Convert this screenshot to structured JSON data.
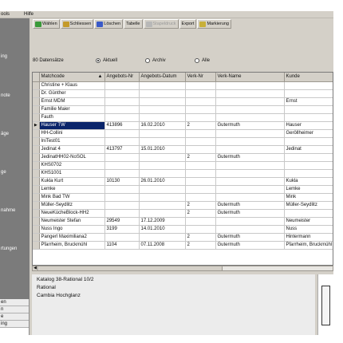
{
  "menubar": {
    "tools": "ools",
    "help": "Hilfe"
  },
  "sidebar": {
    "labels": [
      "ing",
      "note",
      "äge",
      "ge",
      "nahme",
      "rtungen"
    ],
    "bottom": [
      "en",
      "n",
      "e",
      "ing"
    ]
  },
  "toolbar": {
    "buttons": [
      {
        "label": "Wählen",
        "icon": "check-icon",
        "color": "#3a9a3a",
        "disabled": false
      },
      {
        "label": "Schliessen",
        "icon": "close-door-icon",
        "color": "#c49a2a",
        "disabled": false
      },
      {
        "label": "Löschen",
        "icon": "delete-icon",
        "color": "#3a5ac8",
        "disabled": false
      },
      {
        "label": "Tabelle",
        "icon": "",
        "color": "",
        "disabled": false
      },
      {
        "label": "Stapeldruck",
        "icon": "printer-icon",
        "color": "#9a9a9a",
        "disabled": true
      },
      {
        "label": "Export",
        "icon": "",
        "color": "",
        "disabled": false
      },
      {
        "label": "Markierung",
        "icon": "marker-icon",
        "color": "#c8b03a",
        "disabled": false
      }
    ]
  },
  "filter": {
    "count": "80 Datensätze",
    "options": [
      {
        "label": "Aktuell",
        "selected": true
      },
      {
        "label": "Archiv",
        "selected": false
      },
      {
        "label": "Alle",
        "selected": false
      }
    ]
  },
  "grid": {
    "columns": [
      "Matchcode",
      "Angebots-Nr",
      "Angebots-Datum",
      "Verk-Nr",
      "Verk-Name",
      "Kunde"
    ],
    "selected_row": 4,
    "rows": [
      [
        "Christine + Klaus",
        "",
        "",
        "",
        "",
        ""
      ],
      [
        "Dr. Günther",
        "",
        "",
        "",
        "",
        ""
      ],
      [
        "Ernst MDM",
        "",
        "",
        "",
        "",
        "Ernst"
      ],
      [
        "Familie Maier",
        "",
        "",
        "",
        "",
        ""
      ],
      [
        "Fauth",
        "",
        "",
        "",
        "",
        ""
      ],
      [
        "Hauser TW",
        "413896",
        "16.02.2010",
        "2",
        "Gutermuth",
        "Hauser"
      ],
      [
        "HH-Collini",
        "",
        "",
        "",
        "",
        "Geröllheimer"
      ],
      [
        "IniTest01",
        "",
        "",
        "",
        "",
        ""
      ],
      [
        "Jedinat 4",
        "413797",
        "15.01.2010",
        "",
        "",
        "Jedinat"
      ],
      [
        "JedinatHH02-NoSOL",
        "",
        "",
        "2",
        "Gutermuth",
        ""
      ],
      [
        "KHS0702",
        "",
        "",
        "",
        "",
        ""
      ],
      [
        "KHS1001",
        "",
        "",
        "",
        "",
        ""
      ],
      [
        "Kukla Kurt",
        "10130",
        "26.01.2010",
        "",
        "",
        "Kukla"
      ],
      [
        "Lemke",
        "",
        "",
        "",
        "",
        "Lemke"
      ],
      [
        "Mink Bad TW",
        "",
        "",
        "",
        "",
        "Mink"
      ],
      [
        "Müller-Seydlitz",
        "",
        "",
        "2",
        "Gutermuth",
        "Müller-Seydlitz"
      ],
      [
        "NeueKücheBlock-HH2",
        "",
        "",
        "2",
        "Gutermuth",
        ""
      ],
      [
        "Neumeister Stefan",
        "29549",
        "17.12.2009",
        "",
        "",
        "Neumeister"
      ],
      [
        "Nuss Ingo",
        "3199",
        "14.01.2010",
        "",
        "",
        "Nuss"
      ],
      [
        "Pangerl Maximiliana2",
        "",
        "",
        "2",
        "Gutermuth",
        "Hintermann"
      ],
      [
        "Pfarrheim, Bruckmühl",
        "1104",
        "07.11.2008",
        "2",
        "Gutermuth",
        "Pfarrheim, Bruckmühl"
      ]
    ]
  },
  "detail": {
    "lines": [
      "Katalog 38-Rational 10/2",
      "Rational",
      "Cambia Hochglanz"
    ]
  }
}
